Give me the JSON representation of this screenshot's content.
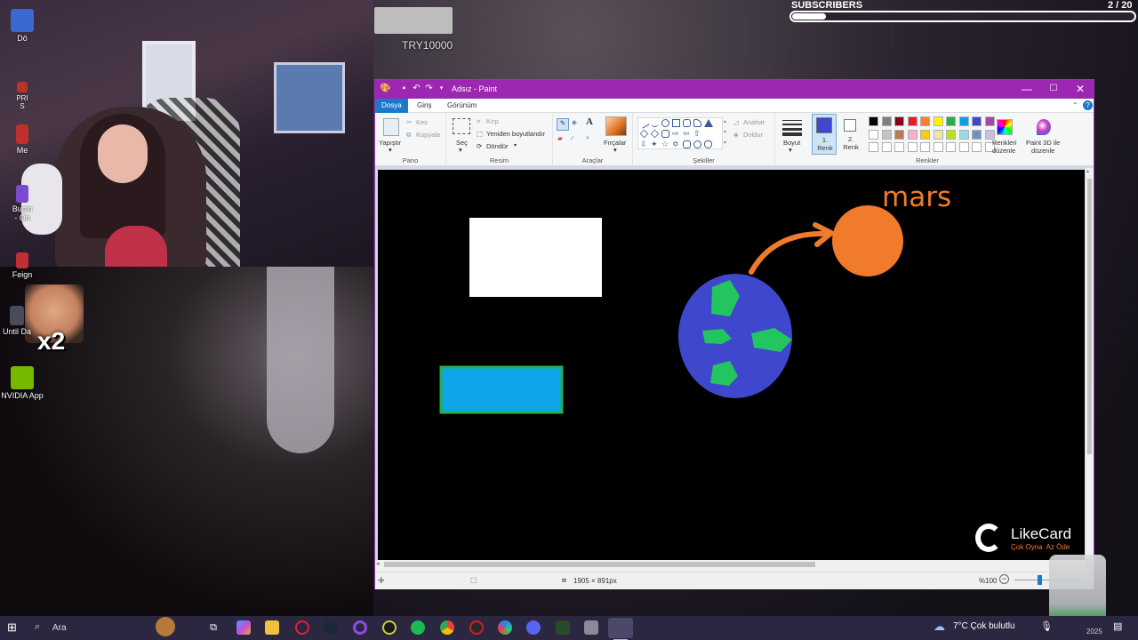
{
  "overlay": {
    "promo_code": "TRY10000",
    "subscribers": {
      "title": "SUBSCRIBERS",
      "count": "2 / 20",
      "progress": 0.1
    },
    "multiplier": "x2"
  },
  "desktop_icons": [
    {
      "label": "Dö",
      "color": "#3a6ad0"
    },
    {
      "label": "PRI\nS",
      "color": "#c0302a"
    },
    {
      "label": "Me",
      "color": "#c0302a"
    },
    {
      "label": "Busin\n- On",
      "color": "#7a4ad0"
    },
    {
      "label": "Feign",
      "color": "#c03030"
    },
    {
      "label": "Until Da",
      "color": "#4a4a5a"
    },
    {
      "label": "NVIDIA App",
      "color": "#76b900"
    }
  ],
  "paint": {
    "title": "Adsız - Paint",
    "window_controls": {
      "minimize": "—",
      "maximize": "☐",
      "close": "✕"
    },
    "tabs": [
      {
        "label": "Dosya",
        "active": true
      },
      {
        "label": "Giriş",
        "active": false
      },
      {
        "label": "Görünüm",
        "active": false
      }
    ],
    "ribbon": {
      "pano": {
        "label": "Pano",
        "paste": "Yapıştır",
        "cut": "Kes",
        "copy": "Kopyala"
      },
      "resim": {
        "label": "Resim",
        "select": "Seç",
        "crop": "Kırp",
        "resize": "Yeniden boyutlandır",
        "rotate": "Döndür"
      },
      "araclar": {
        "label": "Araçlar",
        "brushes": "Fırçalar"
      },
      "sekiller": {
        "label": "Şekiller",
        "outline": "Anahat",
        "fill": "Doldur"
      },
      "size": "Boyut",
      "color1": "1.\nRenk",
      "color2": "2.\nRenk",
      "renkler": {
        "label": "Renkler",
        "edit_colors": "Renkleri\ndüzenle",
        "paint3d": "Paint 3D ile\ndüzenle"
      },
      "palette": [
        "#000000",
        "#7f7f7f",
        "#880015",
        "#ed1c24",
        "#ff7f27",
        "#fff200",
        "#22b14c",
        "#00a2e8",
        "#3f48cc",
        "#a349a4",
        "#ffffff",
        "#c3c3c3",
        "#b97a57",
        "#ffaec9",
        "#ffc90e",
        "#efe4b0",
        "#b5e61d",
        "#99d9ea",
        "#7092be",
        "#c8bfe7"
      ],
      "primary_color": "#3f48cc"
    },
    "canvas": {
      "text_mars": "mars",
      "mars_color": "#f07b2a",
      "earth_color": "#3f48cc",
      "land_color": "#22c55e",
      "blue_rect_color": "#0ea5e9"
    },
    "status": {
      "dimensions": "1905 × 891px",
      "zoom": "%100"
    }
  },
  "likecard": {
    "name": "LikeCard",
    "slogan": "Çok Oyna  Az Öde"
  },
  "taskbar": {
    "search_placeholder": "Ara",
    "weather": "7°C  Çok bulutlu",
    "date_fragment": "2025"
  }
}
